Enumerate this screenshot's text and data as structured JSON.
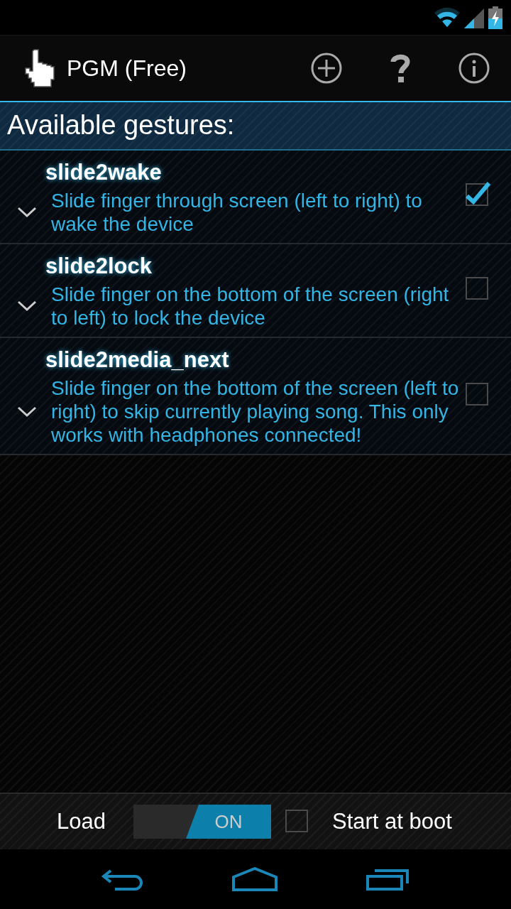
{
  "app": {
    "title": "PGM (Free)"
  },
  "section_header": "Available gestures:",
  "gestures": [
    {
      "name": "slide2wake",
      "description": "Slide finger through screen (left to right) to wake the device",
      "checked": true
    },
    {
      "name": "slide2lock",
      "description": "Slide finger on the bottom of the screen (right to left) to lock the device",
      "checked": false
    },
    {
      "name": "slide2media_next",
      "description": "Slide finger on the bottom of the screen (left to right) to skip currently playing song. This only works with headphones connected!",
      "checked": false
    }
  ],
  "bottom_bar": {
    "load_label": "Load",
    "load_switch": {
      "label": "ON",
      "on": true
    },
    "start_at_boot": {
      "label": "Start at boot",
      "checked": false
    }
  }
}
